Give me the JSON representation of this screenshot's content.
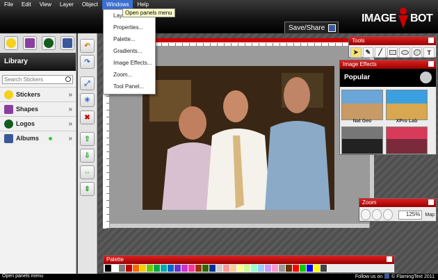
{
  "menubar": {
    "items": [
      "File",
      "Edit",
      "View",
      "Layer",
      "Object",
      "Windows",
      "Help"
    ],
    "active": "Windows",
    "tooltip": "Open panels menu"
  },
  "windows_menu": {
    "items": [
      "Layers...",
      "Properties...",
      "Palette...",
      "Gradients...",
      "Image Effects...",
      "Zoom...",
      "Tool Panel..."
    ]
  },
  "brand": {
    "logo_left": "IMAGE",
    "logo_right": "BOT",
    "accent": "#cc0000"
  },
  "save_share": {
    "label": "Save/Share"
  },
  "library": {
    "title": "Library",
    "tabs_icons": [
      "smiley-icon",
      "star-icon",
      "logo-icon",
      "facebook-icon"
    ],
    "search_placeholder": "Search Stickers",
    "categories": [
      {
        "label": "Stickers",
        "icon": "smiley-icon"
      },
      {
        "label": "Shapes",
        "icon": "star-icon"
      },
      {
        "label": "Logos",
        "icon": "logo-icon"
      },
      {
        "label": "Albums",
        "icon": "facebook-icon"
      }
    ]
  },
  "toolcol": {
    "icons": [
      "undo-icon",
      "redo-icon",
      "fit-icon",
      "center-icon",
      "delete-icon",
      "move-up-icon",
      "move-down-icon",
      "flip-h-icon",
      "flip-v-icon"
    ]
  },
  "tools_panel": {
    "title": "Tools",
    "tools": [
      "pointer-icon",
      "pen-icon",
      "line-icon",
      "rect-icon",
      "ellipse-icon",
      "blob-icon",
      "text-icon"
    ],
    "text_tool_glyph": "T"
  },
  "effects_panel": {
    "title": "Image Effects",
    "section": "Popular",
    "effects": [
      {
        "label": "Nat Geo"
      },
      {
        "label": "XPro Lab"
      },
      {
        "label": ""
      },
      {
        "label": ""
      }
    ]
  },
  "zoom_panel": {
    "title": "Zoom",
    "value": "125",
    "unit": "%",
    "map_label": "Map"
  },
  "palette_panel": {
    "title": "Palette",
    "colors": [
      "#000000",
      "#ffffff",
      "#7f7f7f",
      "#c00000",
      "#ff6600",
      "#ffcc00",
      "#66cc00",
      "#00aa44",
      "#00aaaa",
      "#0066cc",
      "#6633cc",
      "#cc33cc",
      "#ff3399",
      "#993300",
      "#336600",
      "#003399",
      "#cccccc",
      "#ff9999",
      "#ffcc99",
      "#ffff99",
      "#ccff99",
      "#99ffcc",
      "#99ccff",
      "#cc99ff",
      "#ff99cc",
      "#999999",
      "#663300",
      "#ff0000",
      "#00cc00",
      "#0000ff",
      "#ffff00",
      "#444444"
    ]
  },
  "status": {
    "left": "Open panels menu",
    "follow": "Follow us on",
    "copyright": "© FlamingText 2011"
  }
}
